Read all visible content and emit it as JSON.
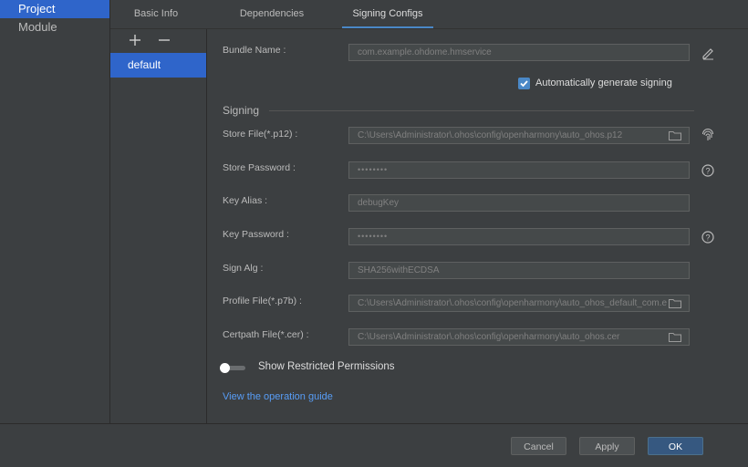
{
  "sidebar": {
    "items": [
      {
        "label": "Project"
      },
      {
        "label": "Module"
      }
    ]
  },
  "tabs": [
    {
      "label": "Basic Info"
    },
    {
      "label": "Dependencies"
    },
    {
      "label": "Signing Configs"
    }
  ],
  "configs": {
    "items": [
      {
        "label": "default"
      }
    ]
  },
  "form": {
    "bundle_name": {
      "label": "Bundle Name :",
      "value": "com.example.ohdome.hmservice"
    },
    "auto_sign": {
      "label": "Automatically generate signing",
      "checked": true
    },
    "section_title": "Signing",
    "store_file": {
      "label": "Store File(*.p12) :",
      "value": "C:\\Users\\Administrator\\.ohos\\config\\openharmony\\auto_ohos.p12"
    },
    "store_password": {
      "label": "Store Password :",
      "value": "••••••••"
    },
    "key_alias": {
      "label": "Key Alias :",
      "value": "debugKey"
    },
    "key_password": {
      "label": "Key Password :",
      "value": "••••••••"
    },
    "sign_alg": {
      "label": "Sign Alg :",
      "value": "SHA256withECDSA"
    },
    "profile_file": {
      "label": "Profile File(*.p7b) :",
      "value": "C:\\Users\\Administrator\\.ohos\\config\\openharmony\\auto_ohos_default_com.e"
    },
    "certpath_file": {
      "label": "Certpath File(*.cer) :",
      "value": "C:\\Users\\Administrator\\.ohos\\config\\openharmony\\auto_ohos.cer"
    },
    "restricted": {
      "label": "Show Restricted Permissions",
      "on": false
    },
    "guide_link": "View the operation guide"
  },
  "footer": {
    "cancel": "Cancel",
    "apply": "Apply",
    "ok": "OK"
  },
  "colors": {
    "accent": "#2f65ca",
    "link": "#589df6",
    "checkbox": "#4a88c7",
    "ok_button": "#365880"
  }
}
